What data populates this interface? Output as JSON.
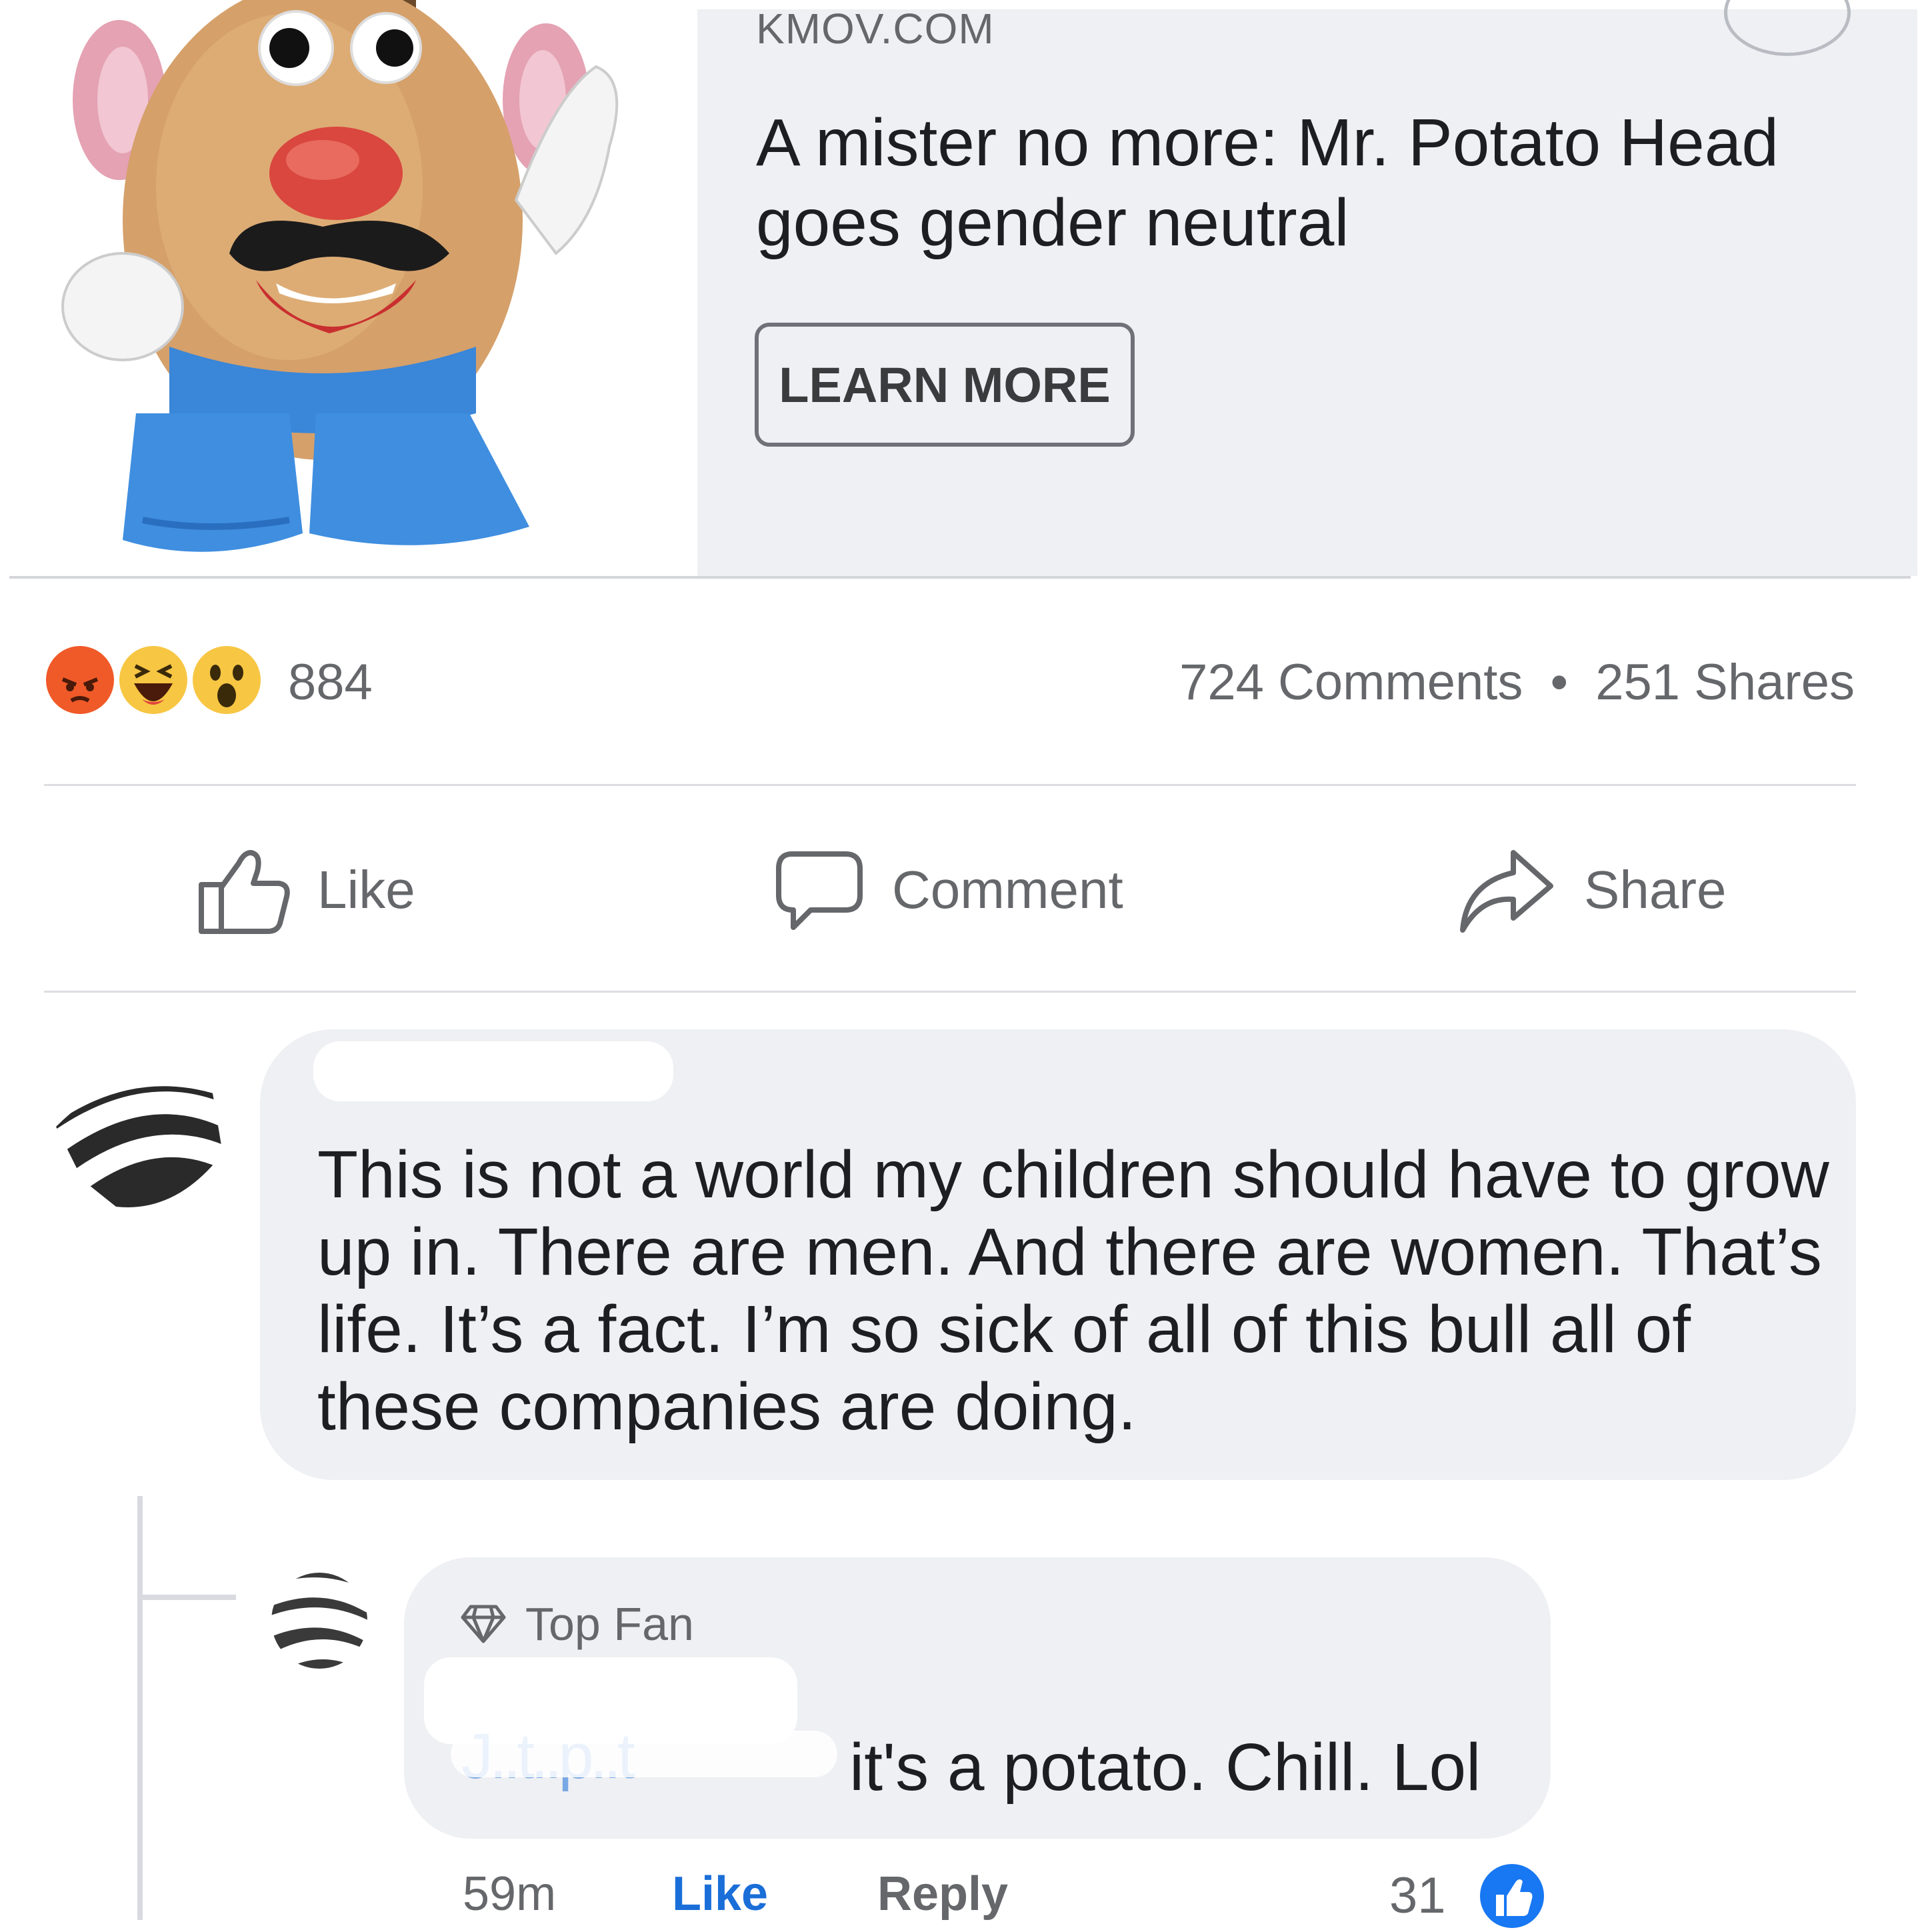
{
  "link_preview": {
    "domain": "KMOV.COM",
    "headline": "A mister no more: Mr. Potato Head goes gender neutral",
    "cta_label": "LEARN MORE"
  },
  "engagement": {
    "reaction_count": "884",
    "reaction_icons": [
      "angry-emoji",
      "haha-emoji",
      "wow-emoji"
    ],
    "comments": "724 Comments",
    "separator": "•",
    "shares": "251 Shares"
  },
  "actions": {
    "like": "Like",
    "comment": "Comment",
    "share": "Share"
  },
  "comments": [
    {
      "text": "This is not a world my children should have to grow up in. There are men. And there are women. That’s life. It’s a fact. I’m so sick of all of this bull all of these companies are doing."
    }
  ],
  "reply": {
    "badge": "Top Fan",
    "mention": "J..t..p..t",
    "text": "it's a potato. Chill. Lol",
    "time": "59m",
    "like_label": "Like",
    "reply_label": "Reply",
    "like_count": "31"
  },
  "colors": {
    "accent": "#1877f2",
    "bubble": "#eff0f3",
    "secondary_text": "#65676b"
  }
}
